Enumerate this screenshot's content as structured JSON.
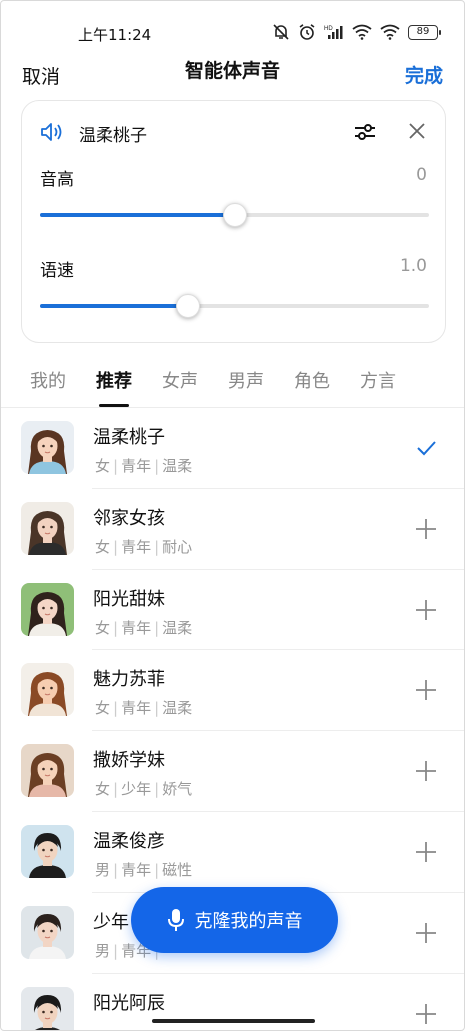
{
  "status_bar": {
    "time": "上午11:24",
    "battery": "89"
  },
  "nav": {
    "cancel": "取消",
    "title": "智能体声音",
    "done": "完成"
  },
  "card": {
    "voice_name": "温柔桃子",
    "pitch": {
      "label": "音高",
      "value": "0",
      "fraction": 0.5
    },
    "speed": {
      "label": "语速",
      "value": "1.0",
      "fraction": 0.38
    }
  },
  "tabs": [
    {
      "label": "我的"
    },
    {
      "label": "推荐"
    },
    {
      "label": "女声"
    },
    {
      "label": "男声"
    },
    {
      "label": "角色"
    },
    {
      "label": "方言"
    }
  ],
  "active_tab": "推荐",
  "voices": [
    {
      "name": "温柔桃子",
      "tags": [
        "女",
        "青年",
        "温柔"
      ],
      "selected": true
    },
    {
      "name": "邻家女孩",
      "tags": [
        "女",
        "青年",
        "耐心"
      ],
      "selected": false
    },
    {
      "name": "阳光甜妹",
      "tags": [
        "女",
        "青年",
        "温柔"
      ],
      "selected": false
    },
    {
      "name": "魅力苏菲",
      "tags": [
        "女",
        "青年",
        "温柔"
      ],
      "selected": false
    },
    {
      "name": "撒娇学妹",
      "tags": [
        "女",
        "少年",
        "娇气"
      ],
      "selected": false
    },
    {
      "name": "温柔俊彦",
      "tags": [
        "男",
        "青年",
        "磁性"
      ],
      "selected": false
    },
    {
      "name": "少年",
      "tags": [
        "男",
        "青年",
        ""
      ],
      "selected": false
    },
    {
      "name": "阳光阿辰",
      "tags": [],
      "selected": false
    }
  ],
  "clone_button": {
    "label": "克隆我的声音"
  },
  "colors": {
    "accent": "#1a6fd8",
    "button": "#1466e8"
  }
}
